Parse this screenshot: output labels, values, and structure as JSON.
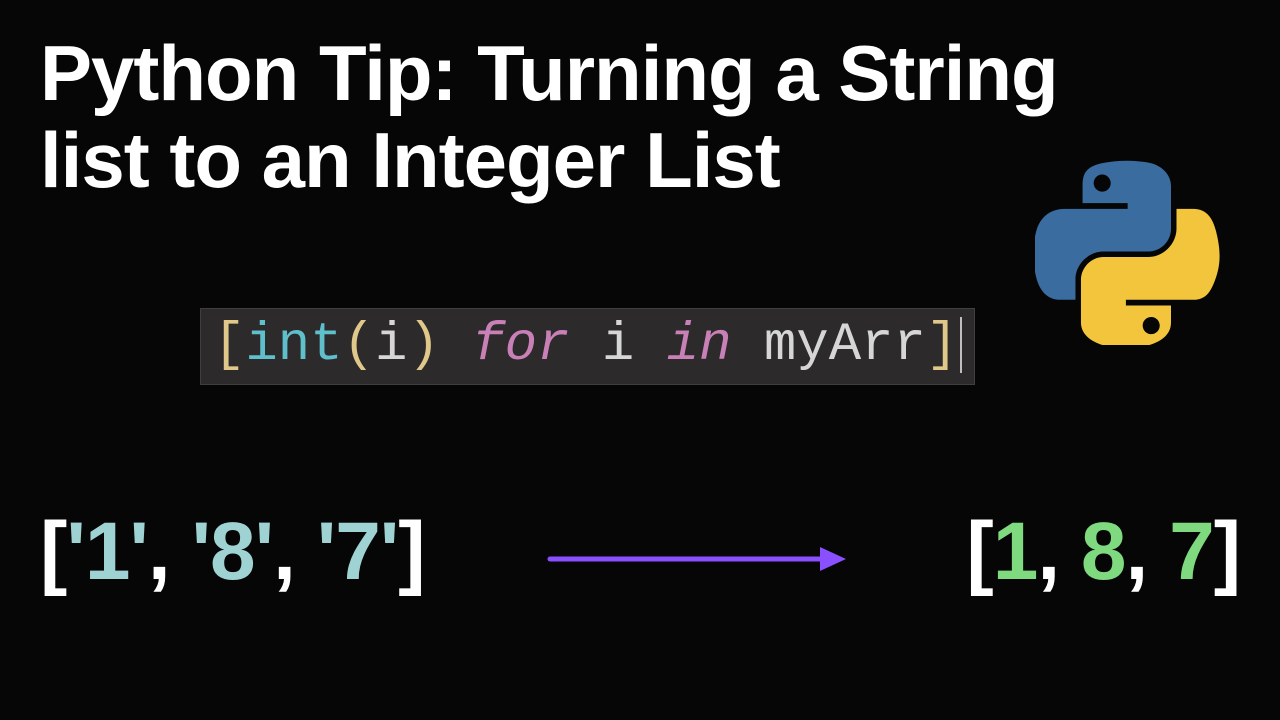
{
  "title_line1": "Python Tip: Turning a String",
  "title_line2": "list to an Integer List",
  "code": {
    "open": "[",
    "fn": "int",
    "lparen": "(",
    "arg": "i",
    "rparen": ")",
    "space1": " ",
    "kw_for": "for",
    "space2": " ",
    "ident_i": "i",
    "space3": " ",
    "kw_in": "in",
    "space4": " ",
    "arr": "myArr",
    "close": "]"
  },
  "string_list": {
    "open": "[",
    "q1a": "'",
    "v1": "1",
    "q1b": "'",
    "c1": ", ",
    "q2a": "'",
    "v2": "8",
    "q2b": "'",
    "c2": ", ",
    "q3a": "'",
    "v3": "7",
    "q3b": "'",
    "close": "]"
  },
  "int_list": {
    "open": "[",
    "v1": "1",
    "c1": ", ",
    "v2": "8",
    "c2": ", ",
    "v3": "7",
    "close": "]"
  }
}
